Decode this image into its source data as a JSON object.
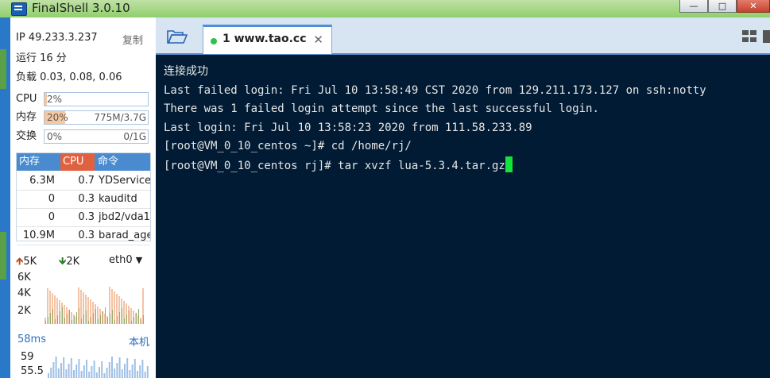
{
  "window": {
    "title": "FinalShell 3.0.10"
  },
  "sidebar": {
    "ip_label": "IP 49.233.3.237",
    "copy_label": "复制",
    "uptime": "运行 16 分",
    "load": "负载 0.03, 0.08, 0.06",
    "cpu": {
      "label": "CPU",
      "percent_text": "2%",
      "percent": 2
    },
    "mem": {
      "label": "内存",
      "percent_text": "20%",
      "percent": 20,
      "amount": "775M/3.7G"
    },
    "swap": {
      "label": "交换",
      "percent_text": "0%",
      "percent": 0,
      "amount": "0/1G"
    },
    "process_table": {
      "headers": [
        "内存",
        "CPU",
        "命令"
      ],
      "rows": [
        {
          "mem": "6.3M",
          "cpu": "0.7",
          "cmd": "YDService"
        },
        {
          "mem": "0",
          "cpu": "0.3",
          "cmd": "kauditd"
        },
        {
          "mem": "0",
          "cpu": "0.3",
          "cmd": "jbd2/vda1"
        },
        {
          "mem": "10.9M",
          "cpu": "0.3",
          "cmd": "barad_agent"
        }
      ]
    },
    "network": {
      "upload": "5K",
      "download": "2K",
      "interface": "eth0",
      "y_labels": [
        "6K",
        "4K",
        "2K"
      ]
    },
    "ping": {
      "latency": "58ms",
      "target": "本机",
      "y_labels": [
        "59",
        "55.5"
      ]
    }
  },
  "tabs": [
    {
      "label": "1 www.tao.cc",
      "status_color": "#2fc04a"
    }
  ],
  "terminal": {
    "lines": [
      "连接成功",
      "Last failed login: Fri Jul 10 13:58:49 CST 2020 from 129.211.173.127 on ssh:notty",
      "There was 1 failed login attempt since the last successful login.",
      "Last login: Fri Jul 10 13:58:23 2020 from 111.58.233.89",
      "[root@VM_0_10_centos ~]# cd /home/rj/",
      "[root@VM_0_10_centos rj]# tar xvzf lua-5.3.4.tar.gz"
    ]
  },
  "icons": {
    "open_folder": "folder-open-icon",
    "layout": "grid-layout-icon",
    "close_tab": "close-icon"
  }
}
